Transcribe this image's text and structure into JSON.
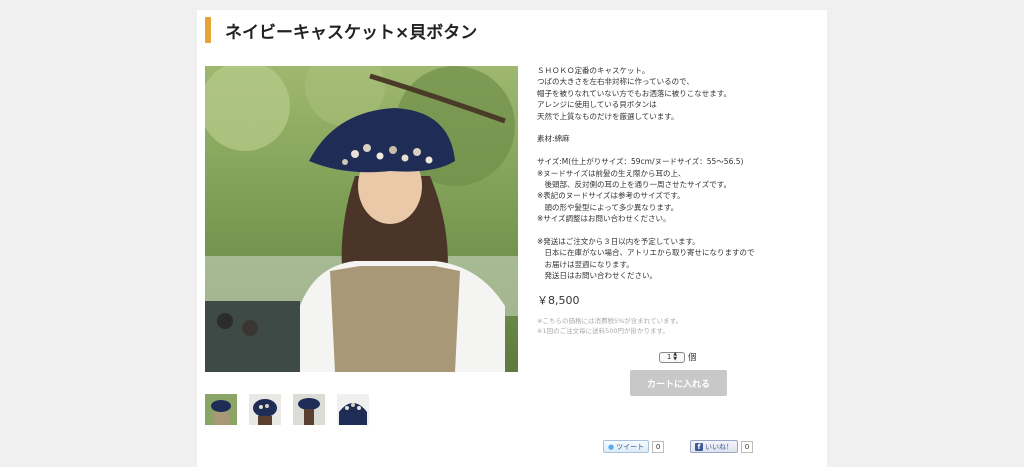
{
  "product": {
    "title": "ネイビーキャスケット×貝ボタン",
    "description": [
      "ＳＨＯＫＯ定番のキャスケット。",
      "つばの大きさを左右非対称に作っているので、",
      "帽子を被りなれていない方でもお洒落に被りこなせます。",
      "アレンジに使用している貝ボタンは",
      "天然で上質なものだけを厳選しています。",
      "",
      "素材:綿麻",
      "",
      "サイズ:M(仕上がりサイズ：59cm/ヌードサイズ：55〜56.5)",
      "※ヌードサイズは前髪の生え際から耳の上、",
      "　後頭部、反対側の耳の上を通り一周させたサイズです。",
      "※表記のヌードサイズは参考のサイズです。",
      "　頭の形や髪型によって多少異なります。",
      "※サイズ調整はお問い合わせください。",
      "",
      "※発送はご注文から３日以内を予定しています。",
      "　日本に在庫がない場合、アトリエから取り寄せになりますので",
      "　お届けは翌週になります。",
      "　発送日はお問い合わせください。"
    ],
    "price": "￥8,500",
    "notes": [
      "※こちらの価格には消費税5%が含まれています。",
      "※1回のご注文毎に送料500円が掛かります。"
    ]
  },
  "purchase": {
    "quantity": "1",
    "unit": "個",
    "cart_label": "カートに入れる"
  },
  "social": {
    "tweet_label": "ツイート",
    "tweet_count": "0",
    "like_label": "いいね！",
    "like_count": "0"
  },
  "colors": {
    "accent": "#e8a23a",
    "button_disabled": "#c8c8c8",
    "background": "#f0f0f0"
  }
}
